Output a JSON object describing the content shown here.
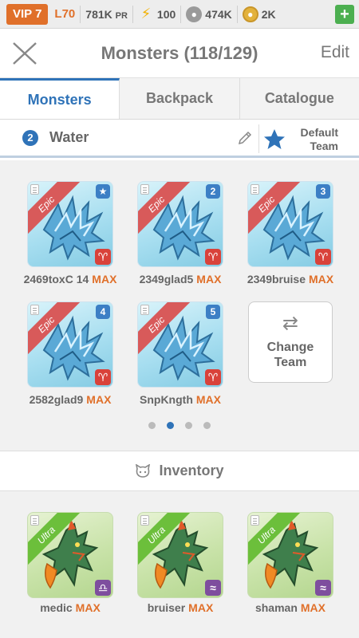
{
  "status": {
    "vip": "VIP 7",
    "level": "L70",
    "pr_value": "781K",
    "pr_unit": "PR",
    "energy": "100",
    "food": "474K",
    "gold": "2K",
    "plus": "+"
  },
  "header": {
    "title": "Monsters (118/129)",
    "edit": "Edit"
  },
  "tabs": [
    "Monsters",
    "Backpack",
    "Catalogue"
  ],
  "team": {
    "number": "2",
    "name": "Water",
    "default_line1": "Default",
    "default_line2": "Team"
  },
  "team_monsters": [
    {
      "name": "2469toxC 14",
      "max": "MAX",
      "rarity": "Epic",
      "badge": "★",
      "element": "♈"
    },
    {
      "name": "2349glad5",
      "max": "MAX",
      "rarity": "Epic",
      "badge": "2",
      "element": "♈"
    },
    {
      "name": "2349bruise",
      "max": "MAX",
      "rarity": "Epic",
      "badge": "3",
      "element": "♈"
    },
    {
      "name": "2582glad9",
      "max": "MAX",
      "rarity": "Epic",
      "badge": "4",
      "element": "♈"
    },
    {
      "name": "SnpKngth",
      "max": "MAX",
      "rarity": "Epic",
      "badge": "5",
      "element": "♈"
    }
  ],
  "change_team": {
    "line1": "Change",
    "line2": "Team",
    "icon": "swap-arrows-icon"
  },
  "pagination": {
    "pages": 4,
    "active": 2
  },
  "inventory": {
    "title": "Inventory",
    "items": [
      {
        "name": "medic",
        "max": "MAX",
        "rarity": "Ultra",
        "element": "♎"
      },
      {
        "name": "bruiser",
        "max": "MAX",
        "rarity": "Ultra",
        "element": "≈"
      },
      {
        "name": "shaman",
        "max": "MAX",
        "rarity": "Ultra",
        "element": "≈"
      }
    ]
  },
  "colors": {
    "accent": "#2f73b8",
    "vip": "#e0702a",
    "max": "#e0702a",
    "epic": "#d85a5a",
    "ultra": "#6cbf3b"
  }
}
